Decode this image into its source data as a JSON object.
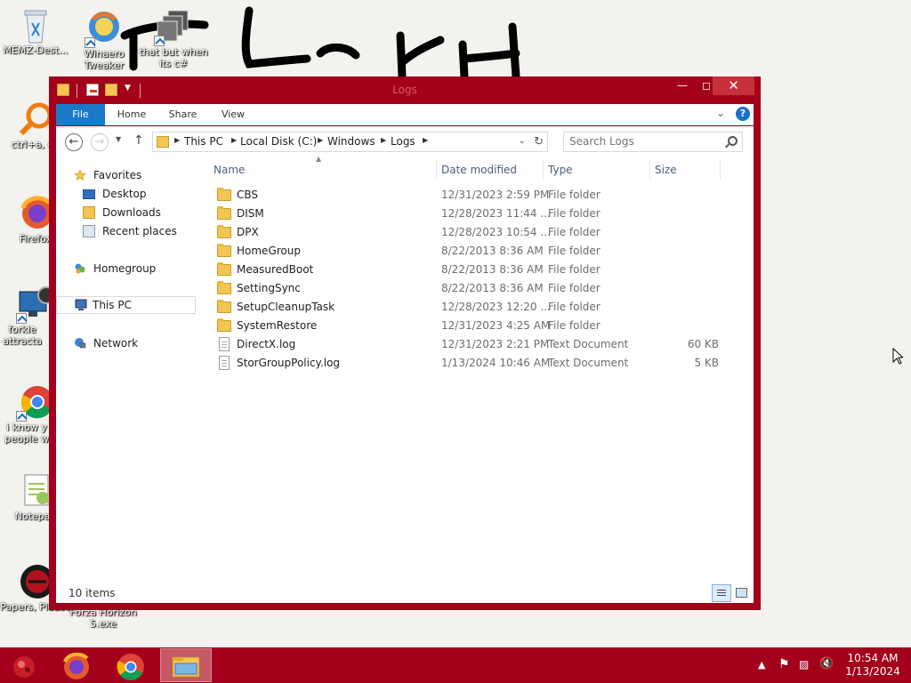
{
  "desktop": {
    "icons": [
      {
        "label": "MEMZ-Dest..."
      },
      {
        "label": "Winaero Tweaker"
      },
      {
        "label": "that but when its c#"
      },
      {
        "label": "ctrl+a, en"
      },
      {
        "label": "Firefox"
      },
      {
        "label": "forkie attracta"
      },
      {
        "label": "i know y people w"
      },
      {
        "label": "Notepad"
      },
      {
        "label": "Papers, Please"
      },
      {
        "label": "Forza Horizon 5.exe"
      }
    ]
  },
  "window": {
    "title": "Logs",
    "ribbon": {
      "tabs": [
        "File",
        "Home",
        "Share",
        "View"
      ]
    },
    "address": {
      "crumbs": [
        "This PC",
        "Local Disk (C:)",
        "Windows",
        "Logs"
      ]
    },
    "search": {
      "placeholder": "Search Logs"
    },
    "nav": {
      "favorites": "Favorites",
      "desktop": "Desktop",
      "downloads": "Downloads",
      "recent": "Recent places",
      "homegroup": "Homegroup",
      "thispc": "This PC",
      "network": "Network"
    },
    "columns": {
      "name": "Name",
      "date": "Date modified",
      "type": "Type",
      "size": "Size"
    },
    "files": [
      {
        "name": "CBS",
        "date": "12/31/2023 2:59 PM",
        "type": "File folder",
        "size": "",
        "icon": "folder"
      },
      {
        "name": "DISM",
        "date": "12/28/2023 11:44 ...",
        "type": "File folder",
        "size": "",
        "icon": "folder"
      },
      {
        "name": "DPX",
        "date": "12/28/2023 10:54 ...",
        "type": "File folder",
        "size": "",
        "icon": "folder"
      },
      {
        "name": "HomeGroup",
        "date": "8/22/2013 8:36 AM",
        "type": "File folder",
        "size": "",
        "icon": "folder"
      },
      {
        "name": "MeasuredBoot",
        "date": "8/22/2013 8:36 AM",
        "type": "File folder",
        "size": "",
        "icon": "folder"
      },
      {
        "name": "SettingSync",
        "date": "8/22/2013 8:36 AM",
        "type": "File folder",
        "size": "",
        "icon": "folder"
      },
      {
        "name": "SetupCleanupTask",
        "date": "12/28/2023 12:20 ...",
        "type": "File folder",
        "size": "",
        "icon": "folder"
      },
      {
        "name": "SystemRestore",
        "date": "12/31/2023 4:25 AM",
        "type": "File folder",
        "size": "",
        "icon": "folder"
      },
      {
        "name": "DirectX.log",
        "date": "12/31/2023 2:21 PM",
        "type": "Text Document",
        "size": "60 KB",
        "icon": "document"
      },
      {
        "name": "StorGroupPolicy.log",
        "date": "1/13/2024 10:46 AM",
        "type": "Text Document",
        "size": "5 KB",
        "icon": "document"
      }
    ],
    "status": {
      "count": "10 items"
    }
  },
  "taskbar": {
    "clock_time": "10:54 AM",
    "clock_date": "1/13/2024"
  },
  "colors": {
    "accent": "#a3001b",
    "close": "#c7303a",
    "file_tab": "#1979ca"
  }
}
